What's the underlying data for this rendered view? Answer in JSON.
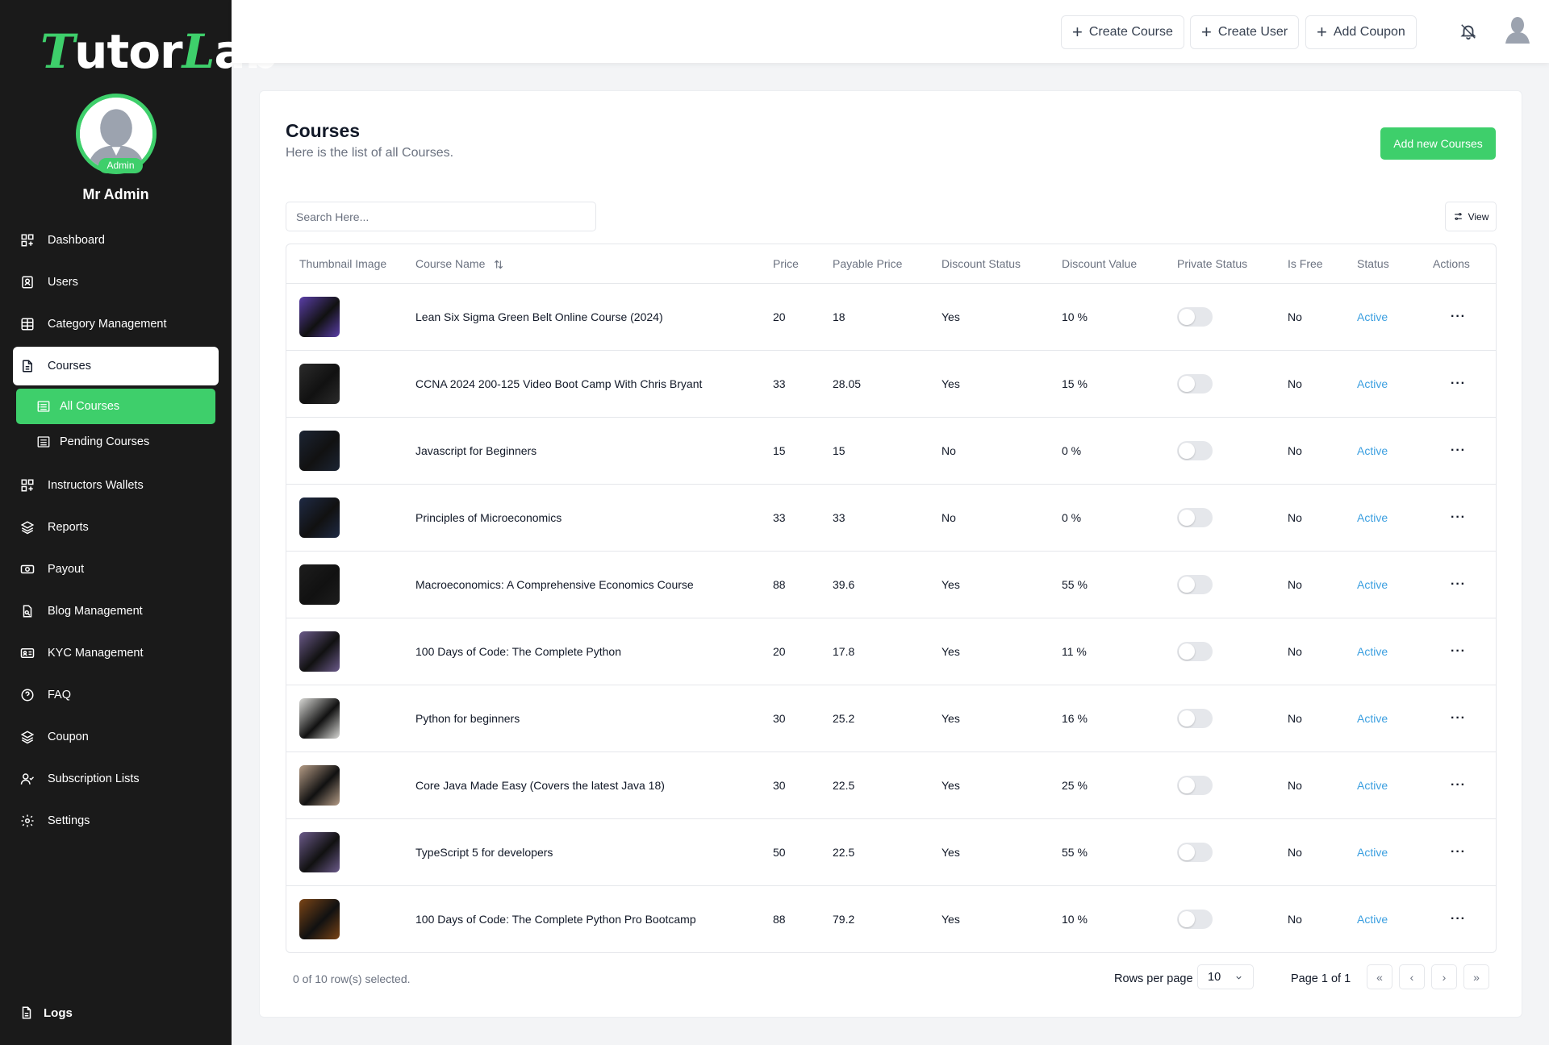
{
  "app": {
    "logo_prefix": "T",
    "logo_mid": "utor",
    "logo_l": "L",
    "logo_suffix": "ab"
  },
  "sidebar": {
    "user_badge": "Admin",
    "user_name": "Mr Admin",
    "items": [
      {
        "label": "Dashboard",
        "icon": "dashboard-icon"
      },
      {
        "label": "Users",
        "icon": "user-badge-icon"
      },
      {
        "label": "Category Management",
        "icon": "table-icon"
      },
      {
        "label": "Courses",
        "icon": "document-icon"
      },
      {
        "label": "Instructors Wallets",
        "icon": "dashboard-icon"
      },
      {
        "label": "Reports",
        "icon": "layers-icon"
      },
      {
        "label": "Payout",
        "icon": "money-icon"
      },
      {
        "label": "Blog Management",
        "icon": "blog-icon"
      },
      {
        "label": "KYC Management",
        "icon": "id-card-icon"
      },
      {
        "label": "FAQ",
        "icon": "question-icon"
      },
      {
        "label": "Coupon",
        "icon": "layers-icon"
      },
      {
        "label": "Subscription Lists",
        "icon": "user-check-icon"
      },
      {
        "label": "Settings",
        "icon": "gear-icon"
      }
    ],
    "sub_items": [
      {
        "label": "All Courses",
        "icon": "list-icon"
      },
      {
        "label": "Pending Courses",
        "icon": "list-icon"
      }
    ],
    "logs_label": "Logs"
  },
  "topbar": {
    "create_course": "Create Course",
    "create_user": "Create User",
    "add_coupon": "Add Coupon"
  },
  "main": {
    "title": "Courses",
    "subtitle": "Here is the list of all Courses.",
    "add_button": "Add new Courses",
    "search_placeholder": "Search Here...",
    "view_button": "View",
    "columns": [
      "Thumbnail Image",
      "Course Name",
      "Price",
      "Payable Price",
      "Discount Status",
      "Discount Value",
      "Private Status",
      "Is Free",
      "Status",
      "Actions"
    ],
    "rows": [
      {
        "name": "Lean Six Sigma Green Belt Online Course (2024)",
        "price": "20",
        "payable": "18",
        "discount_status": "Yes",
        "discount_value": "10 %",
        "private": false,
        "is_free": "No",
        "status": "Active",
        "thumb": "#5a3ea8"
      },
      {
        "name": "CCNA 2024 200-125 Video Boot Camp With Chris Bryant",
        "price": "33",
        "payable": "28.05",
        "discount_status": "Yes",
        "discount_value": "15 %",
        "private": false,
        "is_free": "No",
        "status": "Active",
        "thumb": "#2b2b2b"
      },
      {
        "name": "Javascript for Beginners",
        "price": "15",
        "payable": "15",
        "discount_status": "No",
        "discount_value": "0 %",
        "private": false,
        "is_free": "No",
        "status": "Active",
        "thumb": "#1c2433"
      },
      {
        "name": "Principles of Microeconomics",
        "price": "33",
        "payable": "33",
        "discount_status": "No",
        "discount_value": "0 %",
        "private": false,
        "is_free": "No",
        "status": "Active",
        "thumb": "#1f2a44"
      },
      {
        "name": "Macroeconomics: A Comprehensive Economics Course",
        "price": "88",
        "payable": "39.6",
        "discount_status": "Yes",
        "discount_value": "55 %",
        "private": false,
        "is_free": "No",
        "status": "Active",
        "thumb": "#1d1d1d"
      },
      {
        "name": "100 Days of Code: The Complete Python",
        "price": "20",
        "payable": "17.8",
        "discount_status": "Yes",
        "discount_value": "11 %",
        "private": false,
        "is_free": "No",
        "status": "Active",
        "thumb": "#6b5a8a"
      },
      {
        "name": "Python for beginners",
        "price": "30",
        "payable": "25.2",
        "discount_status": "Yes",
        "discount_value": "16 %",
        "private": false,
        "is_free": "No",
        "status": "Active",
        "thumb": "#d9d9d6"
      },
      {
        "name": "Core Java Made Easy (Covers the latest Java 18)",
        "price": "30",
        "payable": "22.5",
        "discount_status": "Yes",
        "discount_value": "25 %",
        "private": false,
        "is_free": "No",
        "status": "Active",
        "thumb": "#b59c86"
      },
      {
        "name": "TypeScript 5 for developers",
        "price": "50",
        "payable": "22.5",
        "discount_status": "Yes",
        "discount_value": "55 %",
        "private": false,
        "is_free": "No",
        "status": "Active",
        "thumb": "#6b5a8a"
      },
      {
        "name": "100 Days of Code: The Complete Python Pro Bootcamp",
        "price": "88",
        "payable": "79.2",
        "discount_status": "Yes",
        "discount_value": "10 %",
        "private": false,
        "is_free": "No",
        "status": "Active",
        "thumb": "#7a4416"
      }
    ],
    "selected_text": "0 of 10 row(s) selected.",
    "rows_per_page_label": "Rows per page",
    "rows_per_page_value": "10",
    "page_info": "Page 1 of 1"
  },
  "colors": {
    "accent": "#3ecf6b",
    "sidebar_bg": "#1a1a1a",
    "status_active": "#3b9fe0"
  }
}
